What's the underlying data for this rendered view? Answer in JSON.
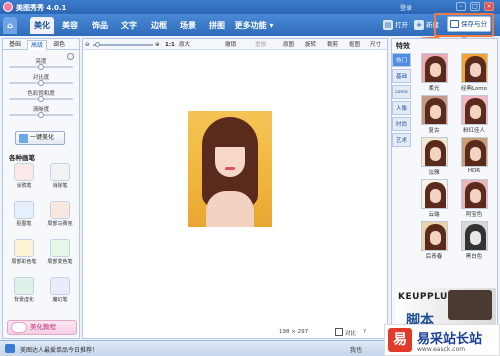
{
  "app": {
    "title": "美图秀秀 4.0.1",
    "account": "登录"
  },
  "tabs": [
    {
      "label": "⌂"
    },
    {
      "label": "美化"
    },
    {
      "label": "美容"
    },
    {
      "label": "饰品"
    },
    {
      "label": "文字"
    },
    {
      "label": "边框"
    },
    {
      "label": "场景"
    },
    {
      "label": "拼图"
    },
    {
      "label": "更多功能"
    }
  ],
  "toolbar_right": {
    "open": "打开",
    "new": "新建",
    "save": "保存与分享"
  },
  "left_panel": {
    "subtabs": [
      "基础",
      "高级",
      "调色"
    ],
    "sliders": [
      {
        "label": "亮度",
        "value": 0.5
      },
      {
        "label": "对比度",
        "value": 0.5
      },
      {
        "label": "色彩饱和度",
        "value": 0.5
      },
      {
        "label": "清晰度",
        "value": 0.5
      }
    ],
    "one_key": "一键美化",
    "pens_title": "各种画笔",
    "pens": [
      "涂鸦笔",
      "消除笔",
      "抠图笔",
      "局部马赛克",
      "局部彩色笔",
      "局部变色笔",
      "背景虚化",
      "魔幻笔"
    ],
    "tutorial": "美化教程"
  },
  "canvas_toolbar": {
    "zoom": "1:1",
    "fit": "原大",
    "undo": "撤销",
    "redo": "重做",
    "original": "原图",
    "rotate": "旋转",
    "crop": "裁剪",
    "cutout": "抠图",
    "size": "尺寸"
  },
  "canvas_status": {
    "dims": "198 × 297",
    "compare": "对比",
    "extra": "?"
  },
  "right_panel": {
    "title": "特效",
    "tabs": [
      "热门",
      "基础",
      "Lomo",
      "人像",
      "时尚",
      "艺术"
    ],
    "effects": [
      "柔光",
      "经典Lomo",
      "复古",
      "粉红佳人",
      "淡雅",
      "HDR",
      "云端",
      "阿宝色",
      "后青春",
      "黑白色"
    ]
  },
  "promo": {
    "line1": "KEUPPLUS",
    "line2": "脚本"
  },
  "status": {
    "text": "美图达人最爱单品今日推荐！",
    "right": "我也"
  },
  "watermark": {
    "logo": "易",
    "name": "易采站长站",
    "url": "www.easck.com"
  },
  "colors": {
    "title_bar": "#2b65b4",
    "highlight": "#f07a3f",
    "pink": "#c0307a"
  }
}
